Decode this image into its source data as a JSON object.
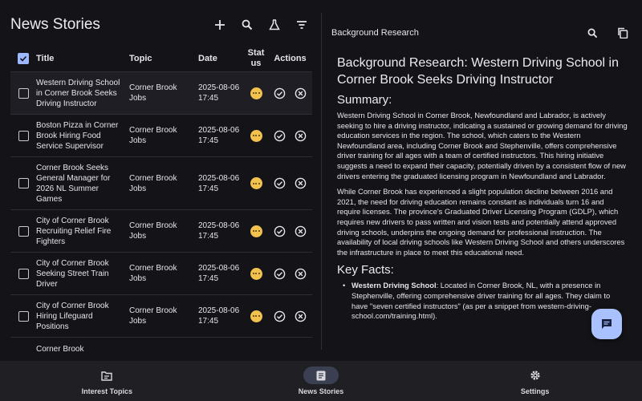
{
  "left": {
    "title": "News Stories",
    "columns": {
      "title": "Title",
      "topic": "Topic",
      "date": "Date",
      "status": "Status",
      "actions": "Actions"
    },
    "rows": [
      {
        "title": "Western Driving School in Corner Brook Seeks Driving Instructor",
        "topic": "Corner Brook Jobs",
        "date": "2025-08-06 17:45",
        "selected": true
      },
      {
        "title": "Boston Pizza in Corner Brook Hiring Food Service Supervisor",
        "topic": "Corner Brook Jobs",
        "date": "2025-08-06 17:45"
      },
      {
        "title": "Corner Brook Seeks General Manager for 2026 NL Summer Games",
        "topic": "Corner Brook Jobs",
        "date": "2025-08-06 17:45"
      },
      {
        "title": "City of Corner Brook Recruiting Relief Fire Fighters",
        "topic": "Corner Brook Jobs",
        "date": "2025-08-06 17:45"
      },
      {
        "title": "City of Corner Brook Seeking Street Train Driver",
        "topic": "Corner Brook Jobs",
        "date": "2025-08-06 17:45"
      },
      {
        "title": "City of Corner Brook Hiring Lifeguard Positions",
        "topic": "Corner Brook Jobs",
        "date": "2025-08-06 17:45"
      },
      {
        "title": "Corner Brook",
        "topic": "",
        "date": ""
      }
    ]
  },
  "right": {
    "panel_title": "Background Research",
    "doc_title": "Background Research: Western Driving School in Corner Brook Seeks Driving Instructor",
    "summary_heading": "Summary:",
    "summary_p1": "Western Driving School in Corner Brook, Newfoundland and Labrador, is actively seeking to hire a driving instructor, indicating a sustained or growing demand for driving education services in the region. The school, which caters to the Western Newfoundland area, including Corner Brook and Stephenville, offers comprehensive driver training for all ages with a team of certified instructors. This hiring initiative suggests a need to expand their capacity, potentially driven by a consistent flow of new drivers entering the graduated licensing program in Newfoundland and Labrador.",
    "summary_p2": "While Corner Brook has experienced a slight population decline between 2016 and 2021, the need for driving education remains constant as individuals turn 16 and require licenses. The province's Graduated Driver Licensing Program (GDLP), which requires new drivers to pass written and vision tests and potentially attend approved driving schools, underpins the ongoing demand for professional instruction. The availability of local driving schools like Western Driving School and others underscores the infrastructure in place to meet this educational need.",
    "facts_heading": "Key Facts:",
    "fact1_bold": "Western Driving School",
    "fact1_text": ": Located in Corner Brook, NL, with a presence in Stephenville, offering comprehensive driver training for all ages. They claim to have \"seven certified instructors\" (as per a snippet from western-driving-school.com/training.html)."
  },
  "nav": {
    "items": [
      {
        "label": "Interest Topics"
      },
      {
        "label": "News Stories",
        "active": true
      },
      {
        "label": "Settings"
      }
    ]
  },
  "colors": {
    "accent": "#a9c2ff",
    "status": "#f2c14e",
    "background": "#141418"
  }
}
